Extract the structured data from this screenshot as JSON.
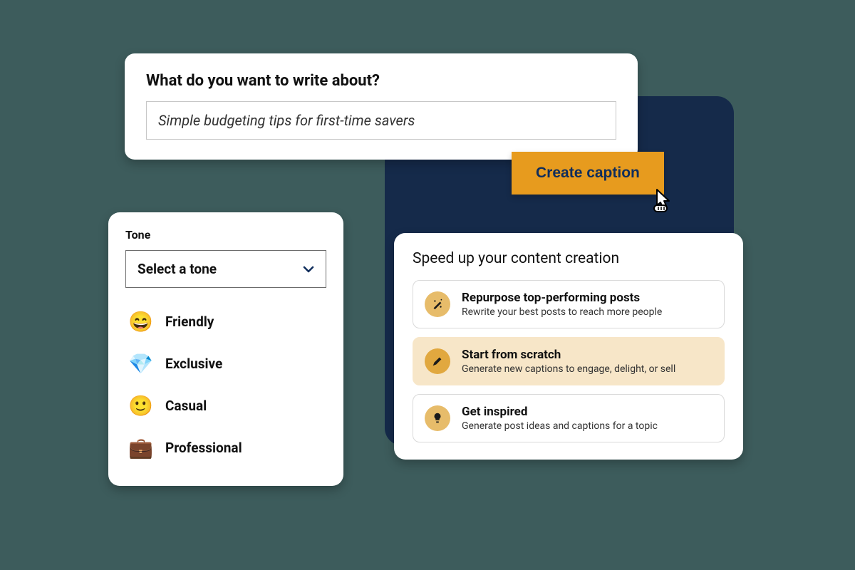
{
  "prompt": {
    "title": "What do you want to write about?",
    "value": "Simple budgeting tips for first-time savers"
  },
  "create_button": {
    "label": "Create caption"
  },
  "tone": {
    "label": "Tone",
    "select_placeholder": "Select a tone",
    "options": [
      {
        "emoji": "😄",
        "label": "Friendly"
      },
      {
        "emoji": "💎",
        "label": "Exclusive"
      },
      {
        "emoji": "🙂",
        "label": "Casual"
      },
      {
        "emoji": "💼",
        "label": "Professional"
      }
    ]
  },
  "speed": {
    "title": "Speed up your content creation",
    "actions": [
      {
        "icon": "sparkle-wand-icon",
        "title": "Repurpose top-performing posts",
        "desc": "Rewrite your best posts to reach more people",
        "active": false
      },
      {
        "icon": "pencil-icon",
        "title": "Start from scratch",
        "desc": "Generate new captions to engage, delight, or sell",
        "active": true
      },
      {
        "icon": "lightbulb-icon",
        "title": "Get inspired",
        "desc": "Generate post ideas and captions for a topic",
        "active": false
      }
    ]
  }
}
